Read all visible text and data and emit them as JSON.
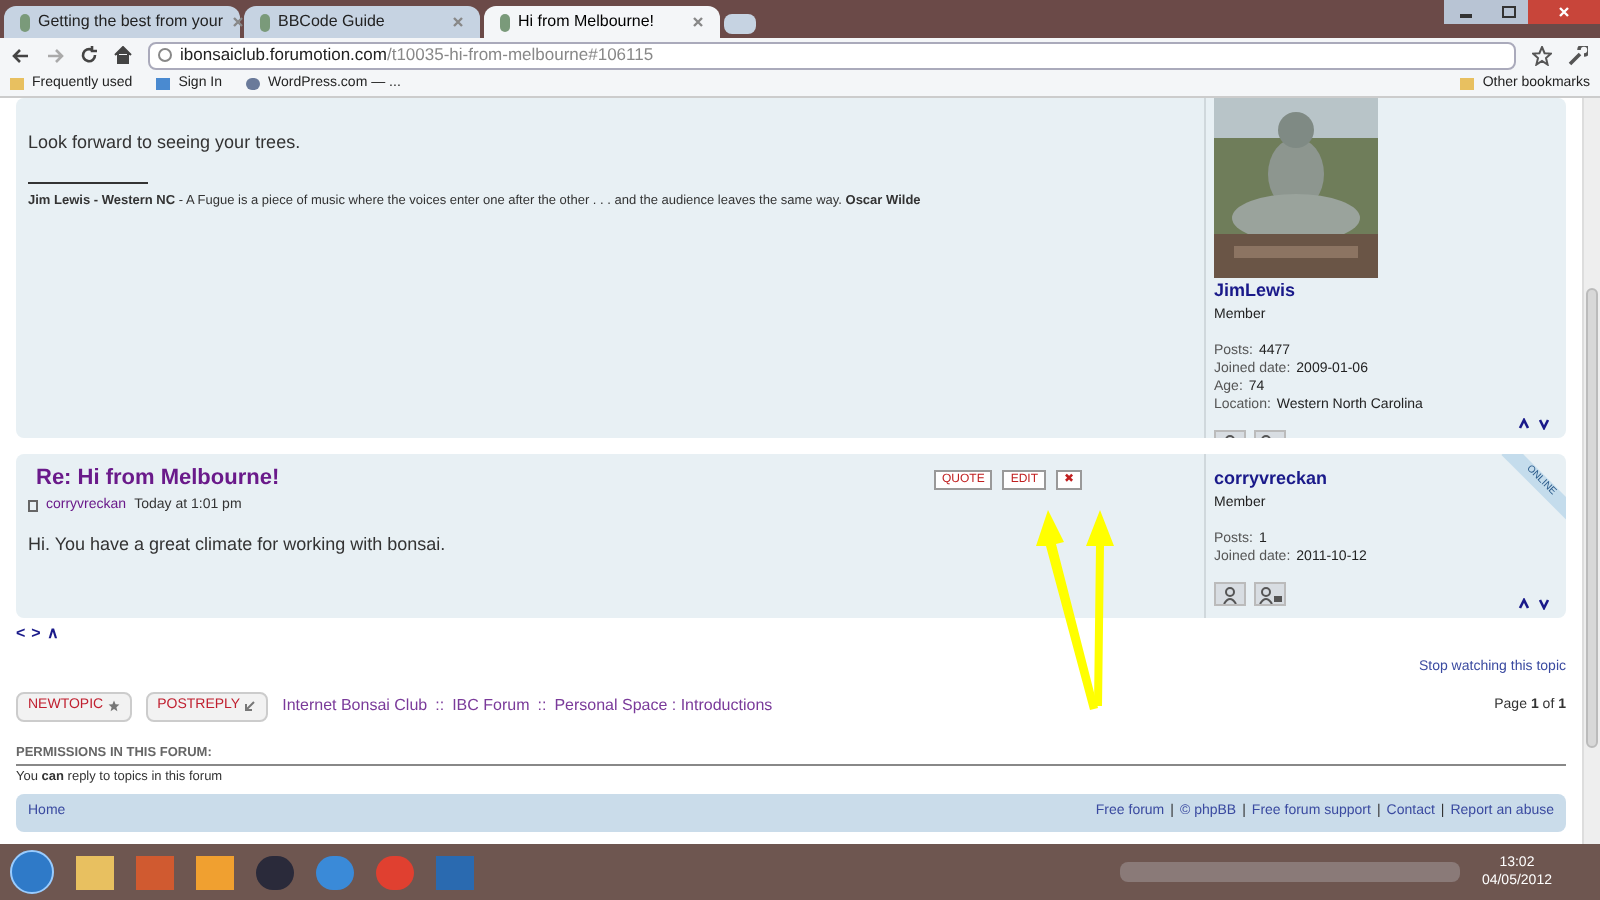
{
  "browser": {
    "tabs": [
      {
        "title": "Getting the best from your",
        "selected": false
      },
      {
        "title": "BBCode Guide",
        "selected": false
      },
      {
        "title": "Hi from Melbourne!",
        "selected": true
      }
    ],
    "address": {
      "domain": "ibonsaiclub.forumotion.com",
      "path": "/t10035-hi-from-melbourne#106115"
    },
    "bookmarks": [
      "Frequently used",
      "Sign In",
      "WordPress.com — ..."
    ],
    "other_bookmarks": "Other bookmarks"
  },
  "posts": [
    {
      "body": "Look forward to seeing your trees.",
      "signature": "**Jim Lewis - Western NC** - A Fugue is a piece of music where the voices enter one after the other . . . and the audience leaves the same way. **Oscar Wilde**",
      "avatar": true,
      "online": false,
      "author": {
        "name": "JimLewis",
        "rank": "Member",
        "stats": [
          [
            "Posts:",
            "4477"
          ],
          [
            "Joined date:",
            "2009-01-06"
          ],
          [
            "Age:",
            "74"
          ],
          [
            "Location:",
            "Western North Carolina"
          ]
        ]
      }
    },
    {
      "title": "Re: Hi from Melbourne!",
      "byline": "corryvreckan",
      "time": "Today at 1:01 pm",
      "body": "Hi. You have a great climate for working with bonsai.",
      "actions": [
        "QUOTE",
        "EDIT",
        "✖"
      ],
      "avatar": false,
      "online": true,
      "online_label": "ONLINE",
      "author": {
        "name": "corryvreckan",
        "rank": "Member",
        "stats": [
          [
            "Posts:",
            "1"
          ],
          [
            "Joined date:",
            "2011-10-12"
          ]
        ]
      }
    }
  ],
  "nav_arrows": [
    "<",
    ">",
    "∧"
  ],
  "watch_link": "Stop watching this topic",
  "buttons": [
    "NEWTOPIC",
    "POSTREPLY"
  ],
  "breadcrumb": {
    "separator": "::",
    "items": [
      "Internet Bonsai Club",
      "IBC Forum",
      "Personal Space : Introductions"
    ]
  },
  "pagination": {
    "prefix": "Page",
    "current": "1",
    "sep": "of",
    "total": "1"
  },
  "permissions": {
    "heading": "PERMISSIONS IN THIS FORUM:",
    "text": "You **can** reply to topics in this forum"
  },
  "footer": {
    "home": "Home",
    "separator": "|",
    "links": [
      "Free forum",
      "© phpBB",
      "Free forum support",
      "Contact",
      "Report an abuse"
    ]
  },
  "taskbar": {
    "time": "13:02",
    "date": "04/05/2012"
  }
}
